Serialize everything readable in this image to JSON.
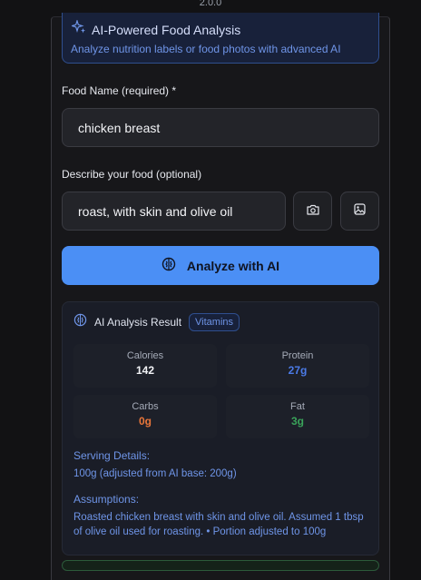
{
  "page": {
    "top_partial_text": "2.0.0"
  },
  "ai_header": {
    "title": "AI-Powered Food Analysis",
    "subtitle": "Analyze nutrition labels or food photos with advanced AI",
    "icon": "sparkles-icon"
  },
  "form": {
    "food_name_label": "Food Name (required) *",
    "food_name_value": "chicken breast",
    "description_label": "Describe your food (optional)",
    "description_value": "roast, with skin and olive oil",
    "camera_icon": "camera-icon",
    "gallery_icon": "image-icon"
  },
  "analyze_button": {
    "label": "Analyze with AI",
    "icon": "brain-icon"
  },
  "result": {
    "title": "AI Analysis Result",
    "badge": "Vitamins",
    "stats": [
      {
        "name": "Calories",
        "value": "142",
        "color": "#f2f3f6"
      },
      {
        "name": "Protein",
        "value": "27g",
        "color": "#4b7be8"
      },
      {
        "name": "Carbs",
        "value": "0g",
        "color": "#e9763a"
      },
      {
        "name": "Fat",
        "value": "3g",
        "color": "#3aa35a"
      }
    ],
    "serving_label": "Serving Details:",
    "serving_text": "100g (adjusted from AI base: 200g)",
    "assumptions_label": "Assumptions:",
    "assumptions_text": "Roasted chicken breast with skin and olive oil. Assumed 1 tbsp of olive oil used for roasting. • Portion adjusted to 100g"
  },
  "colors": {
    "accent": "#4b8ff5",
    "background": "#121214"
  }
}
